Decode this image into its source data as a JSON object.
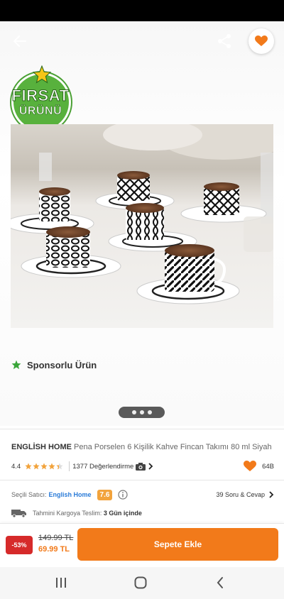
{
  "badge": {
    "line1": "FIRSAT",
    "line2": "ÜRÜNÜ"
  },
  "sponsored": {
    "label": "Sponsorlu Ürün"
  },
  "product": {
    "brand": "ENGLİSH HOME",
    "name": "Pena Porselen 6 Kişilik Kahve Fincan Takımı 80 ml Siyah",
    "rating": "4.4",
    "rating_value": 4.4,
    "rating_max": 5,
    "review_count": "1377 Değerlendirme",
    "favorite_count": "64B"
  },
  "seller": {
    "label": "Seçili Satıcı:",
    "name": "English Home",
    "score": "7.6",
    "qa": "39 Soru & Cevap"
  },
  "shipping": {
    "label": "Tahmini Kargoya Teslim:",
    "value": "3 Gün içinde"
  },
  "purchase": {
    "discount": "-53%",
    "old_price": "149.99 TL",
    "new_price": "69.99 TL",
    "add_to_cart": "Sepete Ekle"
  },
  "colors": {
    "accent": "#f27a1a",
    "badge_green": "#58b13d",
    "discount_red": "#d62a2a",
    "seller_blue": "#2a7bd8",
    "score_orange": "#f2a33c",
    "star_orange": "#f2a33c"
  },
  "icons": {
    "back": "arrow-left-icon",
    "share": "share-icon",
    "favorite": "heart-icon",
    "sponsor": "star-icon",
    "camera": "camera-icon",
    "chevron": "chevron-right-icon",
    "info": "info-icon",
    "truck": "truck-icon"
  },
  "image_pager": {
    "count": 3,
    "active": 0
  }
}
